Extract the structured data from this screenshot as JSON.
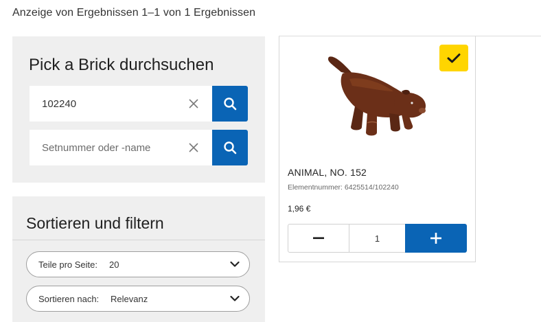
{
  "results_count": "Anzeige von Ergebnissen 1–1 von 1 Ergebnissen",
  "search": {
    "title": "Pick a Brick durchsuchen",
    "element_query": {
      "value": "102240",
      "placeholder": ""
    },
    "set_query": {
      "value": "",
      "placeholder": "Setnummer oder -name"
    },
    "icons": {
      "clear": "close-icon",
      "search": "search-icon"
    }
  },
  "filter": {
    "title": "Sortieren und filtern",
    "per_page": {
      "label": "Teile pro Seite:",
      "value": "20"
    },
    "sort_by": {
      "label": "Sortieren nach:",
      "value": "Relevanz"
    }
  },
  "product": {
    "name": "ANIMAL, NO. 152",
    "element_number": "Elementnummer: 6425514/102240",
    "price": "1,96 €",
    "quantity": "1",
    "selected": true
  },
  "colors": {
    "accent_blue": "#0a64b5",
    "badge_yellow": "#ffd500",
    "panel_grey": "#efefef",
    "brick_brown": "#5e2a16"
  }
}
